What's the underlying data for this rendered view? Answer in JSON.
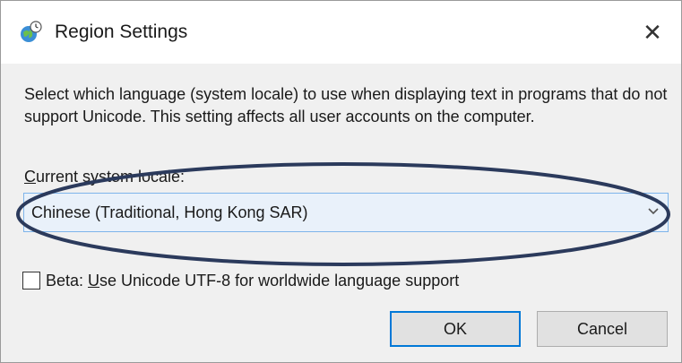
{
  "window": {
    "title": "Region Settings",
    "close_glyph": "✕",
    "icon": "globe-clock-icon"
  },
  "description": "Select which language (system locale) to use when displaying text in programs that do not support Unicode. This setting affects all user accounts on the computer.",
  "locale": {
    "label_accel": "C",
    "label_rest": "urrent system locale:",
    "selected": "Chinese (Traditional, Hong Kong SAR)"
  },
  "beta": {
    "checked": false,
    "label_prefix": "Beta: ",
    "label_accel": "U",
    "label_rest": "se Unicode UTF-8 for worldwide language support"
  },
  "buttons": {
    "ok": "OK",
    "cancel": "Cancel"
  },
  "colors": {
    "select_bg": "#e9f1fa",
    "select_border": "#7eb4ea",
    "annotation": "#2b3a5c",
    "default_button_border": "#0078d7"
  }
}
